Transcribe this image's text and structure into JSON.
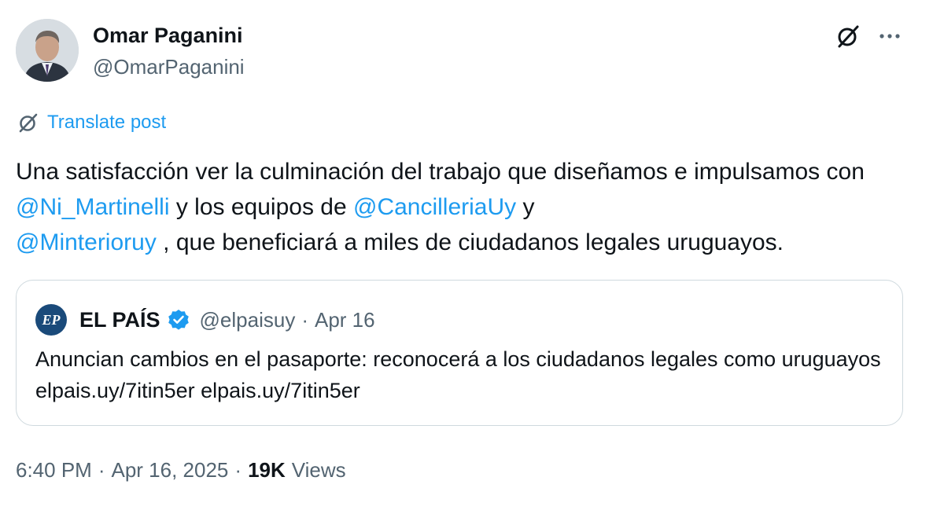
{
  "author": {
    "name": "Omar Paganini",
    "handle": "@OmarPaganini"
  },
  "translate_label": "Translate post",
  "post": {
    "text_1": "Una satisfacción ver la culminación del trabajo que diseñamos e impulsamos con ",
    "mention_1": "@Ni_Martinelli",
    "text_2": " y los equipos de ",
    "mention_2": "@CancilleriaUy",
    "text_3": " y ",
    "mention_3": "@Minterioruy",
    "text_4": " , que beneficiará a miles de ciudadanos legales uruguayos."
  },
  "quote": {
    "logo_text": "EP",
    "name": "EL PAÍS",
    "handle": "@elpaisuy",
    "separator": "·",
    "date": "Apr 16",
    "text": "Anuncian cambios en el pasaporte: reconocerá a los ciudadanos legales como uruguayos elpais.uy/7itin5er elpais.uy/7itin5er"
  },
  "footer": {
    "time": "6:40 PM",
    "separator": "·",
    "date": "Apr 16, 2025",
    "views_count": "19K",
    "views_label": "Views"
  },
  "icons": {
    "grok": "grok-icon",
    "more": "more-icon",
    "translate": "translate-icon",
    "verified": "verified-badge-icon"
  },
  "colors": {
    "accent": "#1d9bf0",
    "secondary_text": "#536471",
    "primary_text": "#0f1419",
    "border": "#cfd9de"
  }
}
